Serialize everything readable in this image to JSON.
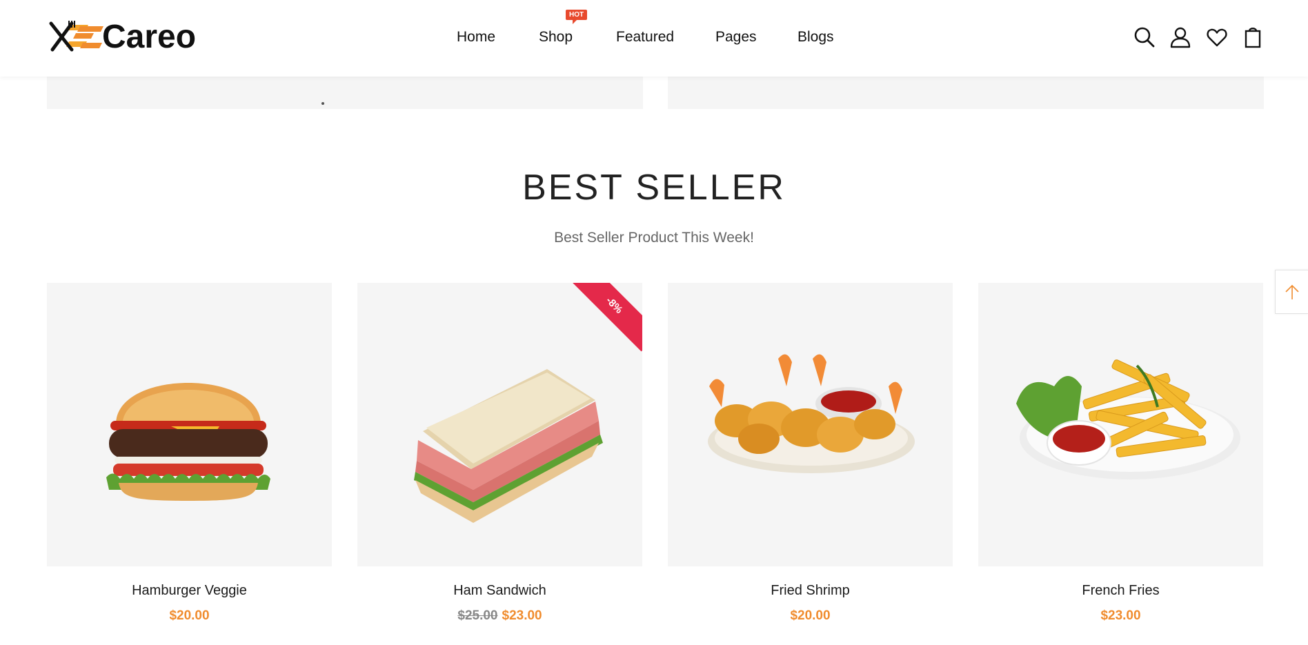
{
  "brand": {
    "name": "Careo"
  },
  "nav": {
    "items": [
      {
        "label": "Home"
      },
      {
        "label": "Shop",
        "badge": "HOT"
      },
      {
        "label": "Featured"
      },
      {
        "label": "Pages"
      },
      {
        "label": "Blogs"
      }
    ]
  },
  "header_icons": [
    "search-icon",
    "user-icon",
    "heart-icon",
    "cart-icon"
  ],
  "section": {
    "title": "BEST SELLER",
    "subtitle": "Best Seller Product This Week!"
  },
  "products": [
    {
      "name": "Hamburger Veggie",
      "price": "$20.00",
      "old_price": "",
      "discount": ""
    },
    {
      "name": "Ham Sandwich",
      "price": "$23.00",
      "old_price": "$25.00",
      "discount": "-8%"
    },
    {
      "name": "Fried Shrimp",
      "price": "$20.00",
      "old_price": "",
      "discount": ""
    },
    {
      "name": "French Fries",
      "price": "$23.00",
      "old_price": "",
      "discount": ""
    }
  ],
  "colors": {
    "accent": "#f08c2e",
    "hot_badge": "#e84a2e",
    "discount_ribbon": "#e4294a",
    "card_bg": "#f5f5f5"
  }
}
